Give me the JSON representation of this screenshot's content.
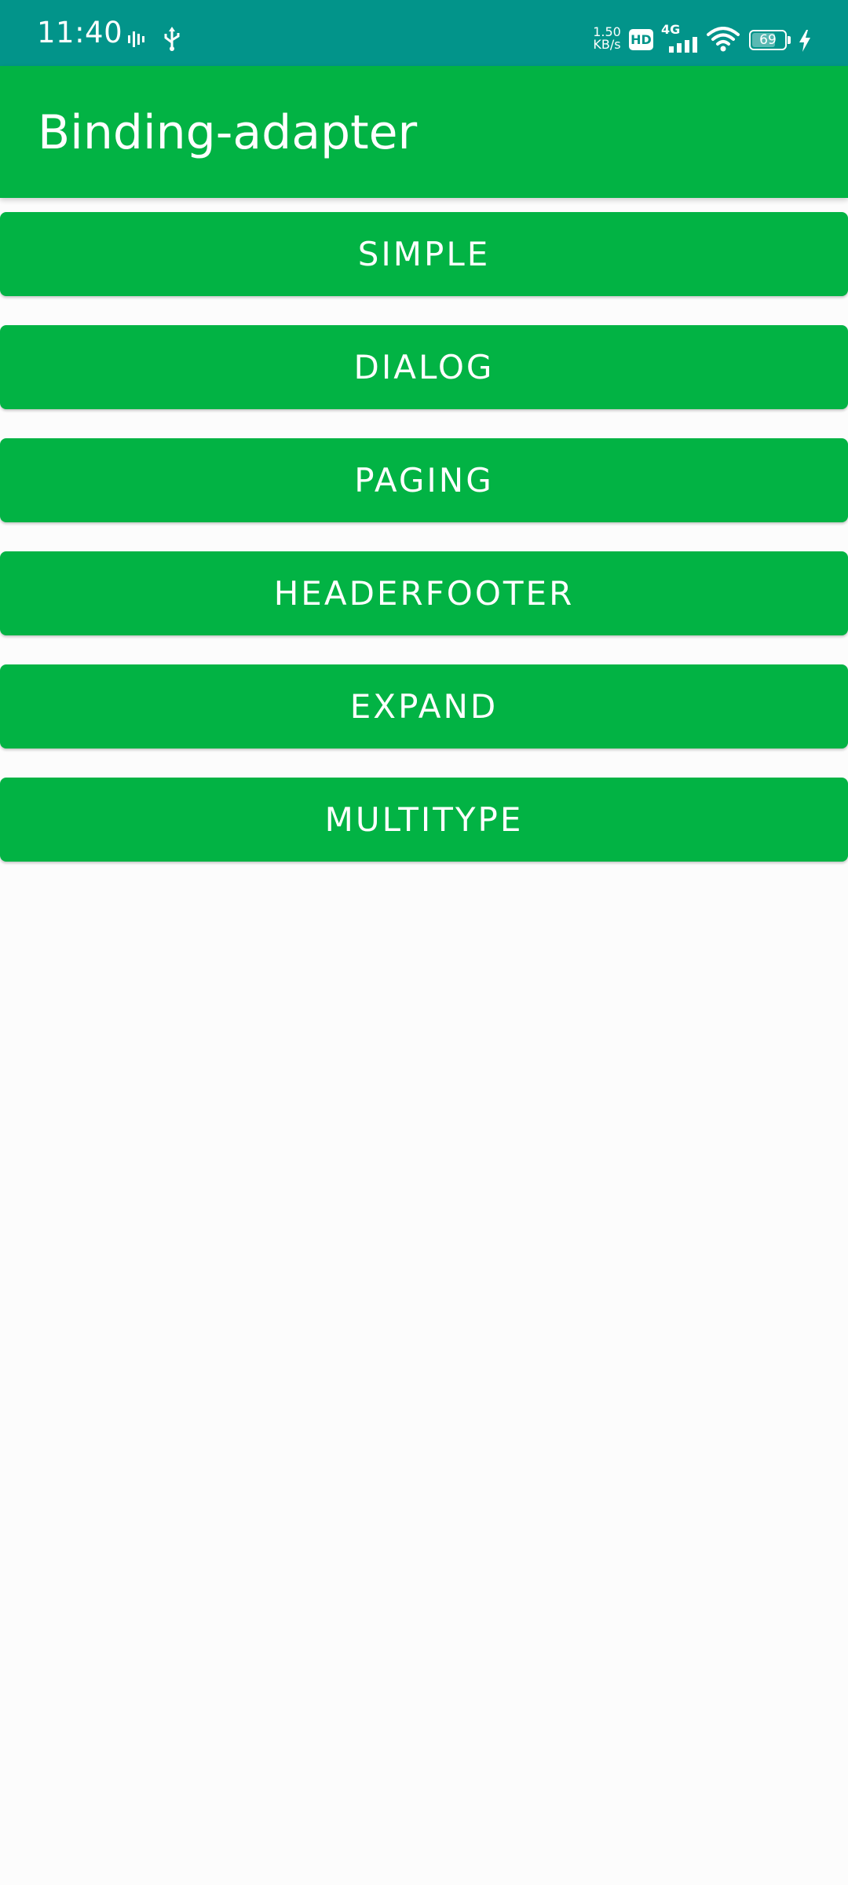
{
  "status_bar": {
    "time": "11:40",
    "net_speed_value": "1.50",
    "net_speed_unit": "KB/s",
    "hd_label": "HD",
    "network_type": "4G",
    "battery_level": "69",
    "background_color": "#02948a",
    "icons": [
      "activity-icon",
      "usb-icon",
      "hd-icon",
      "signal-icon",
      "wifi-icon",
      "battery-icon",
      "charging-icon"
    ]
  },
  "app_bar": {
    "title": "Binding-adapter",
    "background_color": "#02b344"
  },
  "buttons": [
    {
      "label": "SIMPLE"
    },
    {
      "label": "DIALOG"
    },
    {
      "label": "PAGING"
    },
    {
      "label": "HEADERFOOTER"
    },
    {
      "label": "EXPAND"
    },
    {
      "label": "MULTITYPE"
    }
  ],
  "colors": {
    "primary": "#02b344",
    "background": "#fcfcfc",
    "on_primary": "#ffffff"
  }
}
